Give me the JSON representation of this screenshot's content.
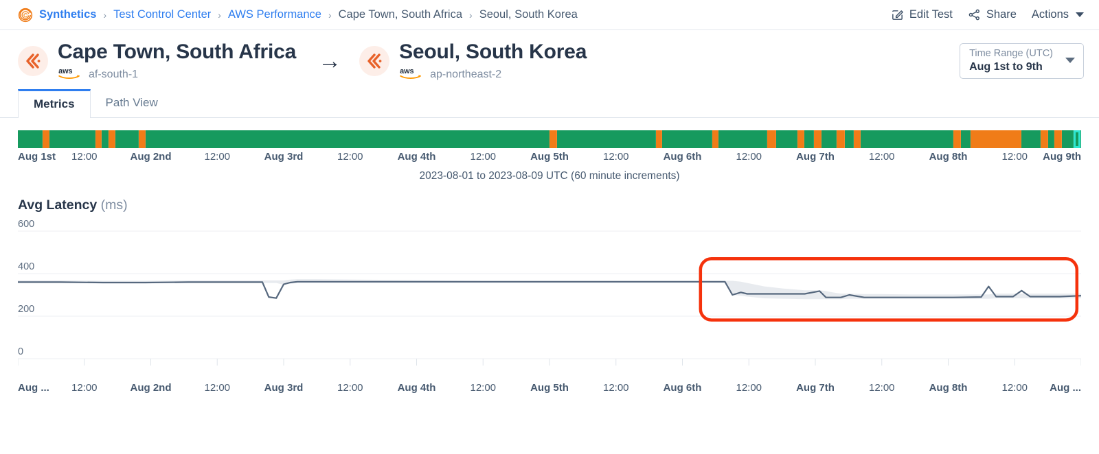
{
  "breadcrumb": {
    "logo_icon": "synthetics-spiral-logo",
    "items": [
      {
        "label": "Synthetics",
        "type": "link-strong"
      },
      {
        "label": "Test Control Center",
        "type": "link"
      },
      {
        "label": "AWS Performance",
        "type": "link"
      },
      {
        "label": "Cape Town, South Africa",
        "type": "current"
      },
      {
        "label": "Seoul, South Korea",
        "type": "current"
      }
    ],
    "separator": "›",
    "actions": [
      {
        "label": "Edit Test",
        "icon": "edit-pencil-icon"
      },
      {
        "label": "Share",
        "icon": "share-nodes-icon"
      },
      {
        "label": "Actions",
        "icon": "chevron-down-icon"
      }
    ]
  },
  "endpoints": {
    "source": {
      "title": "Cape Town, South Africa",
      "provider_icon": "aws-logo",
      "region": "af-south-1",
      "badge_icon": "chevrons-left-icon"
    },
    "arrow": "→",
    "target": {
      "title": "Seoul, South Korea",
      "provider_icon": "aws-logo",
      "region": "ap-northeast-2",
      "badge_icon": "chevrons-left-icon"
    },
    "time_range": {
      "label": "Time Range (UTC)",
      "value": "Aug 1st to 9th",
      "caret_icon": "caret-down-icon"
    }
  },
  "tabs": [
    {
      "label": "Metrics",
      "active": true
    },
    {
      "label": "Path View",
      "active": false
    }
  ],
  "status_strip": {
    "caption": "2023-08-01 to 2023-08-09 UTC (60 minute increments)",
    "colors": {
      "ok": "#169a5e",
      "warn": "#f07c18",
      "selected_outline": "#2ee6d0"
    },
    "tick_labels": [
      {
        "label": "Aug 1st",
        "bold": true,
        "pct": 0.0
      },
      {
        "label": "12:00",
        "bold": false,
        "pct": 6.25
      },
      {
        "label": "Aug 2nd",
        "bold": true,
        "pct": 12.5
      },
      {
        "label": "12:00",
        "bold": false,
        "pct": 18.75
      },
      {
        "label": "Aug 3rd",
        "bold": true,
        "pct": 25.0
      },
      {
        "label": "12:00",
        "bold": false,
        "pct": 31.25
      },
      {
        "label": "Aug 4th",
        "bold": true,
        "pct": 37.5
      },
      {
        "label": "12:00",
        "bold": false,
        "pct": 43.75
      },
      {
        "label": "Aug 5th",
        "bold": true,
        "pct": 50.0
      },
      {
        "label": "12:00",
        "bold": false,
        "pct": 56.25
      },
      {
        "label": "Aug 6th",
        "bold": true,
        "pct": 62.5
      },
      {
        "label": "12:00",
        "bold": false,
        "pct": 68.75
      },
      {
        "label": "Aug 7th",
        "bold": true,
        "pct": 75.0
      },
      {
        "label": "12:00",
        "bold": false,
        "pct": 81.25
      },
      {
        "label": "Aug 8th",
        "bold": true,
        "pct": 87.5
      },
      {
        "label": "12:00",
        "bold": false,
        "pct": 93.75
      },
      {
        "label": "Aug 9th",
        "bold": true,
        "pct": 100.0
      }
    ],
    "segments": [
      {
        "start": 0.0,
        "end": 2.3,
        "status": "ok"
      },
      {
        "start": 2.3,
        "end": 3.0,
        "status": "warn"
      },
      {
        "start": 3.0,
        "end": 7.3,
        "status": "ok"
      },
      {
        "start": 7.3,
        "end": 7.9,
        "status": "warn"
      },
      {
        "start": 7.9,
        "end": 8.5,
        "status": "ok"
      },
      {
        "start": 8.5,
        "end": 9.2,
        "status": "warn"
      },
      {
        "start": 9.2,
        "end": 11.4,
        "status": "ok"
      },
      {
        "start": 11.4,
        "end": 12.0,
        "status": "warn"
      },
      {
        "start": 12.0,
        "end": 50.0,
        "status": "ok"
      },
      {
        "start": 50.0,
        "end": 50.7,
        "status": "warn"
      },
      {
        "start": 50.7,
        "end": 60.0,
        "status": "ok"
      },
      {
        "start": 60.0,
        "end": 60.6,
        "status": "warn"
      },
      {
        "start": 60.6,
        "end": 65.3,
        "status": "ok"
      },
      {
        "start": 65.3,
        "end": 65.9,
        "status": "warn"
      },
      {
        "start": 65.9,
        "end": 70.5,
        "status": "ok"
      },
      {
        "start": 70.5,
        "end": 71.3,
        "status": "warn"
      },
      {
        "start": 71.3,
        "end": 73.3,
        "status": "ok"
      },
      {
        "start": 73.3,
        "end": 74.0,
        "status": "warn"
      },
      {
        "start": 74.0,
        "end": 74.9,
        "status": "ok"
      },
      {
        "start": 74.9,
        "end": 75.6,
        "status": "warn"
      },
      {
        "start": 75.6,
        "end": 77.0,
        "status": "ok"
      },
      {
        "start": 77.0,
        "end": 77.8,
        "status": "warn"
      },
      {
        "start": 77.8,
        "end": 78.6,
        "status": "ok"
      },
      {
        "start": 78.6,
        "end": 79.3,
        "status": "warn"
      },
      {
        "start": 79.3,
        "end": 88.0,
        "status": "ok"
      },
      {
        "start": 88.0,
        "end": 88.7,
        "status": "warn"
      },
      {
        "start": 88.7,
        "end": 89.6,
        "status": "ok"
      },
      {
        "start": 89.6,
        "end": 94.4,
        "status": "warn"
      },
      {
        "start": 94.4,
        "end": 96.2,
        "status": "ok"
      },
      {
        "start": 96.2,
        "end": 96.9,
        "status": "warn"
      },
      {
        "start": 96.9,
        "end": 97.5,
        "status": "ok"
      },
      {
        "start": 97.5,
        "end": 98.2,
        "status": "warn"
      },
      {
        "start": 98.2,
        "end": 99.3,
        "status": "ok"
      },
      {
        "start": 99.3,
        "end": 100.0,
        "status": "selected"
      }
    ]
  },
  "chart_data": {
    "type": "line",
    "title": "Avg Latency",
    "unit": "(ms)",
    "xlabel": "",
    "ylabel": "Avg Latency (ms)",
    "ylim": [
      0,
      600
    ],
    "yticks": [
      0,
      200,
      400,
      600
    ],
    "grid": true,
    "legend": null,
    "xtick_labels": [
      {
        "label": "Aug ...",
        "bold": true,
        "pct": 0.0
      },
      {
        "label": "12:00",
        "bold": false,
        "pct": 6.25
      },
      {
        "label": "Aug 2nd",
        "bold": true,
        "pct": 12.5
      },
      {
        "label": "12:00",
        "bold": false,
        "pct": 18.75
      },
      {
        "label": "Aug 3rd",
        "bold": true,
        "pct": 25.0
      },
      {
        "label": "12:00",
        "bold": false,
        "pct": 31.25
      },
      {
        "label": "Aug 4th",
        "bold": true,
        "pct": 37.5
      },
      {
        "label": "12:00",
        "bold": false,
        "pct": 43.75
      },
      {
        "label": "Aug 5th",
        "bold": true,
        "pct": 50.0
      },
      {
        "label": "12:00",
        "bold": false,
        "pct": 56.25
      },
      {
        "label": "Aug 6th",
        "bold": true,
        "pct": 62.5
      },
      {
        "label": "12:00",
        "bold": false,
        "pct": 68.75
      },
      {
        "label": "Aug 7th",
        "bold": true,
        "pct": 75.0
      },
      {
        "label": "12:00",
        "bold": false,
        "pct": 81.25
      },
      {
        "label": "Aug 8th",
        "bold": true,
        "pct": 87.5
      },
      {
        "label": "12:00",
        "bold": false,
        "pct": 93.75
      },
      {
        "label": "Aug ...",
        "bold": true,
        "pct": 100.0
      }
    ],
    "line_color": "#56687e",
    "band_color": "#e4e8ec",
    "series": [
      {
        "name": "Avg Latency",
        "x": [
          0.0,
          4.0,
          8.0,
          12.0,
          16.0,
          20.0,
          22.0,
          23.0,
          23.6,
          24.3,
          25.0,
          25.6,
          26.3,
          28.0,
          32.0,
          36.0,
          40.0,
          44.0,
          48.0,
          52.0,
          56.0,
          60.0,
          64.0,
          66.5,
          67.2,
          68.0,
          68.6,
          69.4,
          70.2,
          72.0,
          74.0,
          75.4,
          76.0,
          76.6,
          77.4,
          78.2,
          79.6,
          80.4,
          81.2,
          84.0,
          88.0,
          90.6,
          91.3,
          92.0,
          92.8,
          93.6,
          94.4,
          95.2,
          96.0,
          98.0,
          100.0
        ],
        "y": [
          360,
          360,
          358,
          358,
          360,
          360,
          360,
          360,
          290,
          285,
          350,
          358,
          362,
          362,
          362,
          362,
          362,
          362,
          362,
          362,
          362,
          362,
          362,
          362,
          300,
          312,
          305,
          305,
          305,
          305,
          305,
          318,
          288,
          288,
          288,
          300,
          288,
          288,
          288,
          288,
          288,
          290,
          340,
          292,
          292,
          292,
          320,
          292,
          292,
          292,
          296
        ],
        "band_upper": [
          368,
          368,
          366,
          366,
          368,
          368,
          368,
          368,
          368,
          368,
          368,
          372,
          374,
          374,
          372,
          370,
          368,
          366,
          366,
          366,
          366,
          366,
          366,
          366,
          366,
          362,
          356,
          348,
          340,
          330,
          322,
          322,
          318,
          312,
          306,
          306,
          304,
          304,
          304,
          302,
          302,
          302,
          302,
          306,
          306,
          306,
          306,
          306,
          306,
          306,
          306
        ],
        "band_lower": [
          356,
          356,
          354,
          354,
          356,
          356,
          356,
          356,
          356,
          356,
          348,
          352,
          356,
          356,
          356,
          356,
          356,
          356,
          356,
          356,
          356,
          356,
          356,
          356,
          300,
          296,
          292,
          288,
          284,
          282,
          280,
          280,
          280,
          280,
          280,
          282,
          282,
          282,
          282,
          282,
          282,
          282,
          282,
          284,
          284,
          284,
          284,
          284,
          284,
          284,
          284
        ]
      }
    ],
    "annotations": [
      {
        "type": "highlight-rect",
        "name": "red-highlight-box",
        "color": "#f5320c",
        "x_pct_start": 64.2,
        "x_pct_end": 99.6,
        "y_start": 470,
        "y_end": 182
      }
    ]
  }
}
